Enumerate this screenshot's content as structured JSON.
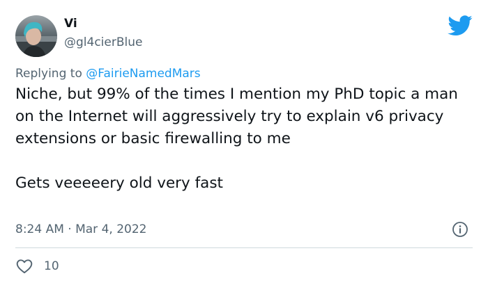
{
  "tweet": {
    "author": {
      "display_name": "Vi",
      "handle": "@gl4cierBlue"
    },
    "reply": {
      "prefix": "Replying to",
      "mention": "@FairieNamedMars"
    },
    "paragraphs": [
      "Niche, but 99% of the times I mention my PhD topic a man on the Internet will aggressively try to explain v6 privacy extensions or basic firewalling to me",
      "Gets veeeeery old very fast"
    ],
    "timestamp": "8:24 AM · Mar 4, 2022",
    "likes": "10"
  },
  "icons": {
    "brand": "twitter-bird-icon",
    "info": "info-icon",
    "like": "heart-icon"
  },
  "colors": {
    "accent": "#1d9bf0",
    "text": "#0f1419",
    "secondary_text": "#536471",
    "divider": "#cfd9de"
  }
}
